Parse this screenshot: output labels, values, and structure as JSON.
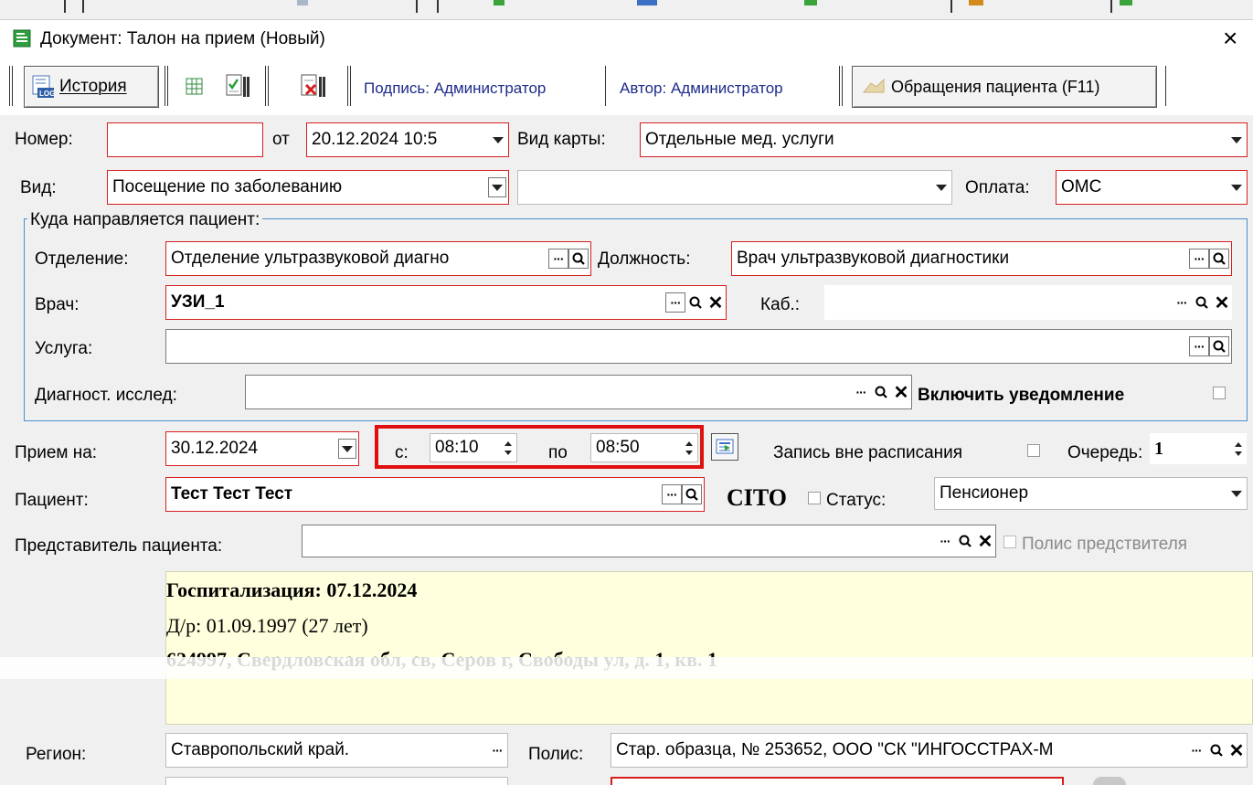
{
  "window": {
    "title": "Документ: Талон на прием (Новый)",
    "close": "×"
  },
  "toolbar": {
    "history_label": "История",
    "signature": "Подпись: Администратор",
    "author": "Автор: Администратор",
    "appeals_label": "Обращения пациента (F11)"
  },
  "row1": {
    "number_label": "Номер:",
    "number_value": "",
    "from_label": "от",
    "from_value": "20.12.2024 10:5",
    "card_label": "Вид карты:",
    "card_value": "Отдельные мед. услуги"
  },
  "row2": {
    "type_label": "Вид:",
    "type_value": "Посещение по заболеванию",
    "extra_value": "",
    "pay_label": "Оплата:",
    "pay_value": "ОМС"
  },
  "referral": {
    "group_label": "Куда направляется пациент:",
    "dept_label": "Отделение:",
    "dept_value": "Отделение ультразвуковой диагно",
    "position_label": "Должность:",
    "position_value": "Врач ультразвуковой диагностики",
    "doctor_label": "Врач:",
    "doctor_value": "УЗИ_1",
    "cab_label": "Каб.:",
    "cab_value": "",
    "service_label": "Услуга:",
    "service_value": "",
    "diag_label": "Диагност. исслед:",
    "diag_value": "",
    "notify_label": "Включить уведомление"
  },
  "appointment": {
    "date_label": "Прием на:",
    "date_value": "30.12.2024",
    "from_label": "с:",
    "from_time": "08:10",
    "to_label": "по",
    "to_time": "08:50",
    "offschedule_label": "Запись вне расписания",
    "queue_label": "Очередь:",
    "queue_value": "1"
  },
  "patient": {
    "label": "Пациент:",
    "value": "Тест Тест Тест",
    "cito": "CITO",
    "status_label": "Статус:",
    "status_value": "Пенсионер",
    "rep_label": "Представитель пациента:",
    "rep_value": "",
    "rep_policy_label": "Полис предствителя"
  },
  "info": {
    "hospitalization": "Госпитализация: 07.12.2024",
    "birth": "Д/р: 01.09.1997 (27 лет)",
    "address": "624997, Свердловская обл, св, Серов г, Свободы ул, д. 1, кв. 1"
  },
  "bottom": {
    "region_label": "Регион:",
    "region_value": "Ставропольский край.",
    "policy_label": "Полис:",
    "policy_value": "Стар. образца, № 253652, ООО \"СК \"ИНГОССТРАХ-М"
  }
}
